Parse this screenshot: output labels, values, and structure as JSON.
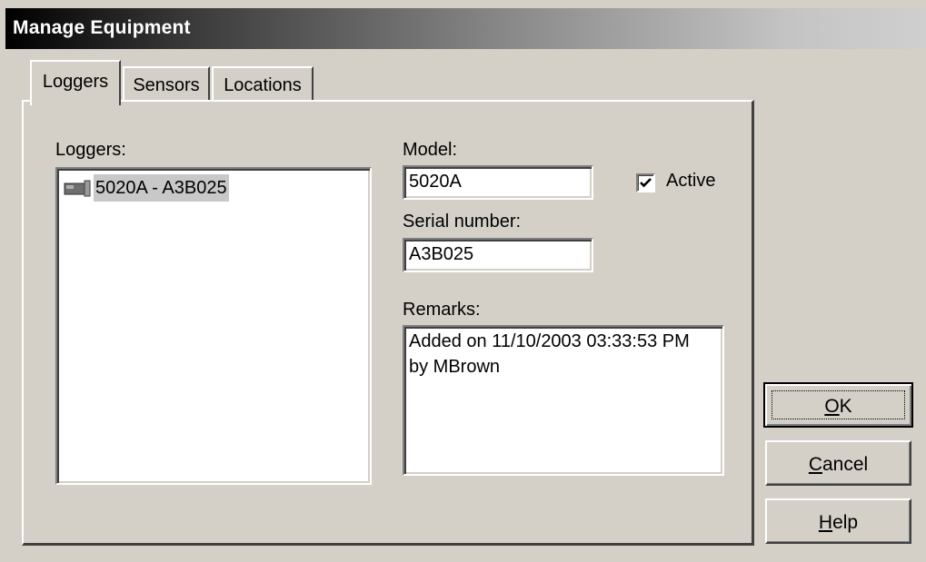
{
  "window": {
    "title": "Manage Equipment"
  },
  "tabs": [
    {
      "label": "Loggers",
      "active": true
    },
    {
      "label": "Sensors",
      "active": false
    },
    {
      "label": "Locations",
      "active": false
    }
  ],
  "loggers_panel": {
    "list_label": "Loggers:",
    "items": [
      {
        "label": "5020A - A3B025",
        "icon": "logger-device-icon",
        "selected": true
      }
    ],
    "model_label": "Model:",
    "model_value": "5020A",
    "active_label": "Active",
    "active_checked": true,
    "serial_label": "Serial number:",
    "serial_value": "A3B025",
    "remarks_label": "Remarks:",
    "remarks_line1": "Added on 11/10/2003 03:33:53 PM",
    "remarks_line2": "by MBrown"
  },
  "buttons": {
    "ok": {
      "mnemonic": "O",
      "rest": "K"
    },
    "cancel": {
      "mnemonic": "C",
      "rest": "ancel"
    },
    "help": {
      "mnemonic": "H",
      "rest": "elp"
    }
  }
}
